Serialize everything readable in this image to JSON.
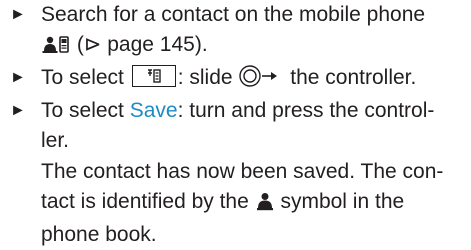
{
  "bullet_symbol": "►",
  "step1": {
    "line1": "Search for a contact on the mobile phone",
    "line2": " (⊳ page 145).",
    "icon": "contact-phone-icon"
  },
  "step2": {
    "before": "To select ",
    "after": ": slide ",
    "end": " the controller.",
    "key_icon": "menu-key-icon",
    "controller_icon": "controller-slide-right-icon"
  },
  "step3": {
    "before": "To select ",
    "highlight": "Save",
    "after_line1": ": turn and press the control-",
    "line2": "ler.",
    "highlight_color": "#1e8bc3"
  },
  "result": {
    "line1": "The contact has now been saved. The con-",
    "line2_before": "tact is identified by the ",
    "line2_after": " symbol in the",
    "line3": "phone book.",
    "symbol_icon": "contact-person-icon"
  }
}
